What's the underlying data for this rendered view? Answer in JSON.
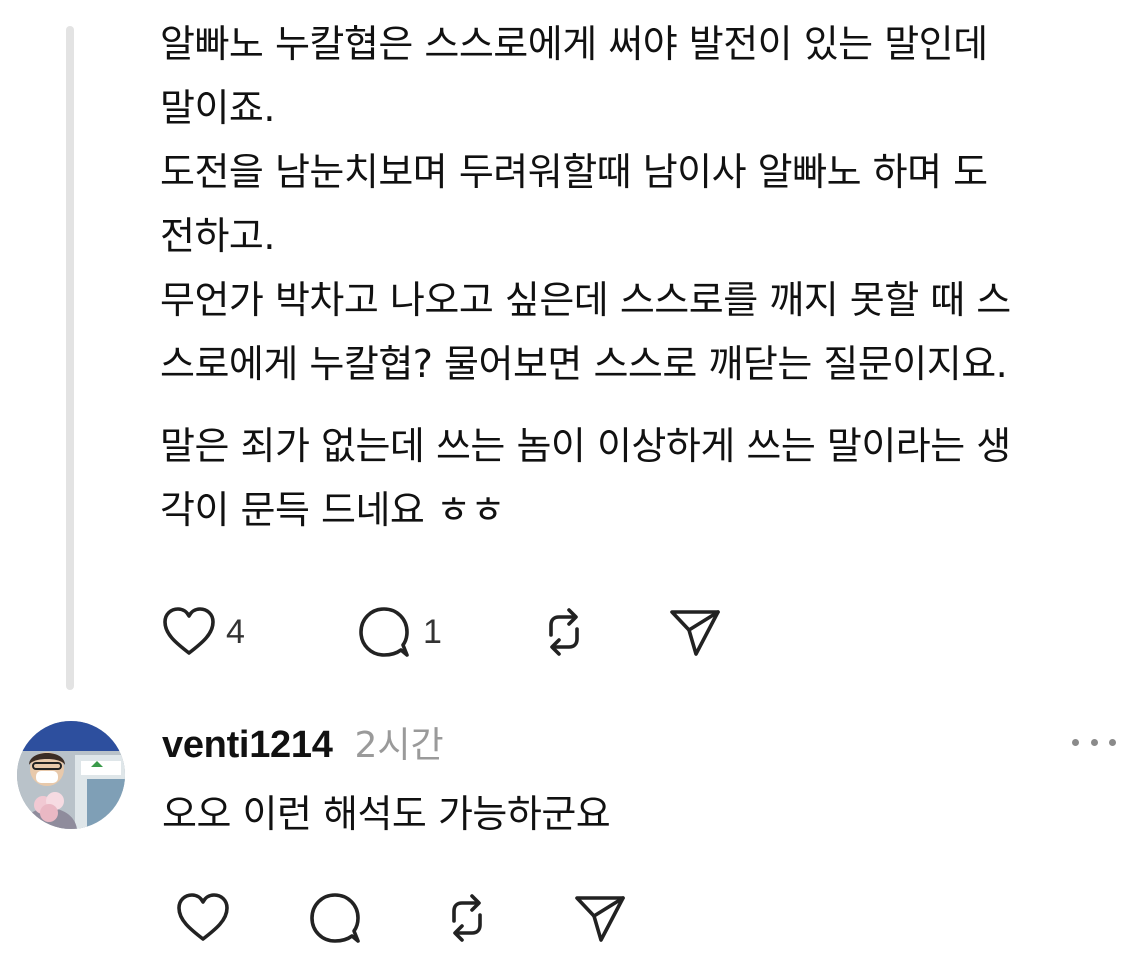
{
  "post": {
    "paragraphs": [
      "알빠노 누칼협은 스스로에게 써야 발전이 있는 말인데\n말이죠.",
      "도전을 남눈치보며 두려워할때 남이사 알빠노 하며 도\n전하고.",
      "무언가 박차고 나오고 싶은데 스스로를 깨지 못할 때 스\n스로에게 누칼협? 물어보면 스스로 깨닫는 질문이지요.",
      "말은 죄가 없는데 쓰는 놈이 이상하게 쓰는 말이라는 생\n각이 문득 드네요 ㅎㅎ"
    ],
    "like_count": "4",
    "reply_count": "1"
  },
  "reply": {
    "username": "venti1214",
    "time": "2시간",
    "text": "오오 이런 해석도 가능하군요"
  },
  "icons": {
    "like": "heart-icon",
    "reply": "speech-bubble-icon",
    "repost": "repost-arrows-icon",
    "share": "paper-plane-icon",
    "more": "more-dots-icon"
  },
  "colors": {
    "text": "#111111",
    "muted": "#9a9a9a",
    "thread_line": "#e3e3e3"
  }
}
